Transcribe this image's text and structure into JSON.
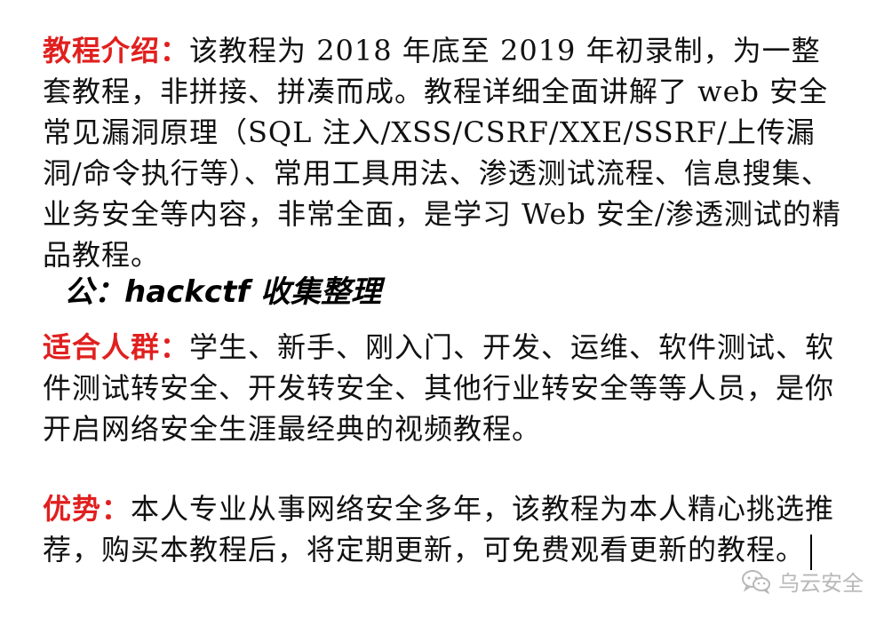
{
  "intro": {
    "label": "教程介绍：",
    "text": "该教程为 2018 年底至 2019 年初录制，为一整套教程，非拼接、拼凑而成。教程详细全面讲解了 web 安全常见漏洞原理（SQL 注入/XSS/CSRF/XXE/SSRF/上传漏洞/命令执行等）、常用工具用法、渗透测试流程、信息搜集、业务安全等内容，非常全面，是学习 Web 安全/渗透测试的精品教程。"
  },
  "subtitle": "公：hackctf 收集整理",
  "audience": {
    "label": "适合人群：",
    "text": "学生、新手、刚入门、开发、运维、软件测试、软件测试转安全、开发转安全、其他行业转安全等等人员，是你开启网络安全生涯最经典的视频教程。"
  },
  "advantage": {
    "label": "优势：",
    "text": "本人专业从事网络安全多年，该教程为本人精心挑选推荐，购买本教程后，将定期更新，可免费观看更新的教程。"
  },
  "watermark": {
    "icon": "wechat-icon",
    "text": "乌云安全"
  },
  "colors": {
    "label": "#e0201f",
    "text": "#111111",
    "watermark": "#b8b8b8"
  }
}
